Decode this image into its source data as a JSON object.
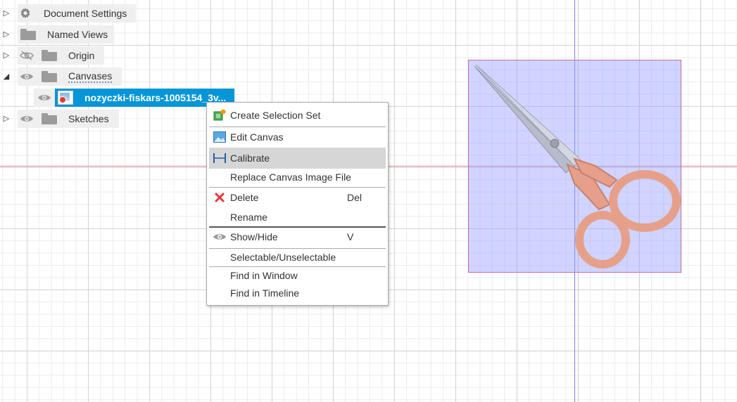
{
  "browser": {
    "rows": [
      {
        "label": "Document Settings",
        "icon": "gear-icon"
      },
      {
        "label": "Named Views",
        "icon": "folder-icon"
      },
      {
        "label": "Origin",
        "icon": "folder-icon",
        "visibility": "hidden-eye-icon"
      },
      {
        "label": "Canvases",
        "icon": "folder-icon",
        "visibility": "eye-icon",
        "expanded": true
      },
      {
        "label": "Sketches",
        "icon": "folder-icon",
        "visibility": "eye-icon"
      }
    ],
    "canvas_item": {
      "label": "nozyczki-fiskars-1005154_3v...",
      "selected": true
    }
  },
  "context_menu": {
    "items": [
      {
        "label": "Create Selection Set",
        "icon": "selection-set-icon",
        "shortcut": ""
      },
      {
        "label": "Edit Canvas",
        "icon": "edit-canvas-icon",
        "shortcut": ""
      },
      {
        "label": "Calibrate",
        "icon": "calibrate-icon",
        "shortcut": "",
        "highlighted": true
      },
      {
        "label": "Replace Canvas Image File",
        "icon": "",
        "shortcut": ""
      },
      {
        "label": "Delete",
        "icon": "delete-x-icon",
        "shortcut": "Del"
      },
      {
        "label": "Rename",
        "icon": "",
        "shortcut": ""
      },
      {
        "label": "Show/Hide",
        "icon": "eye-icon",
        "shortcut": "V"
      },
      {
        "label": "Selectable/Unselectable",
        "icon": "",
        "shortcut": ""
      },
      {
        "label": "Find in Window",
        "icon": "",
        "shortcut": ""
      },
      {
        "label": "Find in Timeline",
        "icon": "",
        "shortcut": ""
      }
    ]
  },
  "colors": {
    "selection": "#0696d7",
    "axis_x": "#e88080",
    "axis_y": "#7f7fe8",
    "canvas_tint": "#96a0ff",
    "delete_red": "#e53935"
  }
}
